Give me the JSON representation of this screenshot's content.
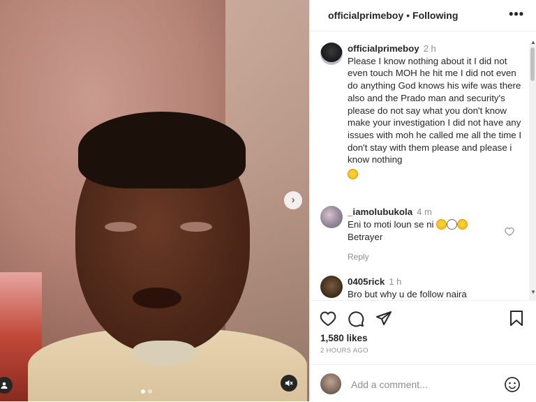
{
  "post": {
    "username": "officialprimeboy",
    "follow_state": "Following",
    "more": "•••"
  },
  "caption": {
    "username": "officialprimeboy",
    "time": "2 h",
    "text": "Please I know nothing about it I did not even touch MOH he hit me I did not even do anything God knows his wife was there also and the Prado man and security's please do not say what you don't know make your investigation I did not have any issues with moh he called me all the time I don't stay with them please and please i know nothing"
  },
  "comments": [
    {
      "username": "_iamolubukola",
      "time": "4 m",
      "text": "Eni to moti loun se ni",
      "text2": "Betrayer",
      "reply": "Reply"
    },
    {
      "username": "0405rick",
      "time": "1 h",
      "text": "Bro but why u de follow naira"
    }
  ],
  "stats": {
    "likes": "1,580 likes",
    "ago": "2 HOURS AGO"
  },
  "composer": {
    "placeholder": "Add a comment..."
  },
  "icons": [
    "heart-icon",
    "comment-icon",
    "share-icon",
    "bookmark-icon",
    "emoji-icon",
    "mute-icon",
    "tag-user-icon",
    "next-arrow-icon"
  ],
  "colors": {
    "text": "#262626",
    "muted": "#8e8e8e",
    "border": "#efefef"
  }
}
